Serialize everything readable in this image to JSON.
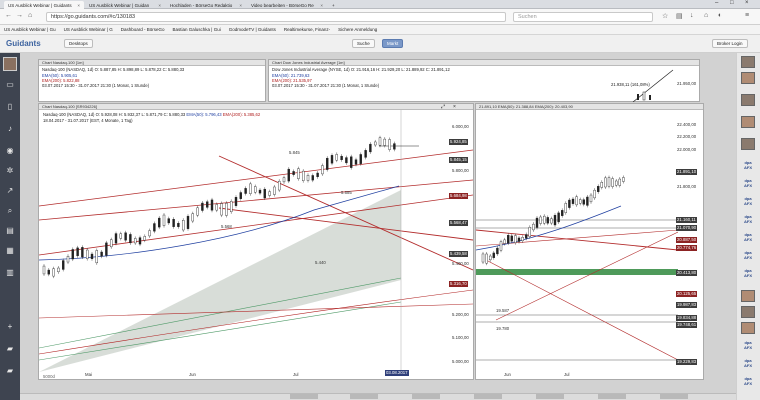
{
  "browser": {
    "tabs": [
      {
        "label": "US Ausblick Webinar | Guidants",
        "active": true
      },
      {
        "label": "US Ausblick Webinar | Guidan",
        "active": false
      },
      {
        "label": "Hochladen - BörseGo Redaktio",
        "active": false
      },
      {
        "label": "Video bearbeiten - BörseGo Re",
        "active": false
      }
    ],
    "url": "https://go.guidants.com/#c/130183",
    "search_placeholder": "Suchen",
    "bookmarks": [
      "US Ausblick Webinar | Gu",
      "US Ausblick Webinar | G",
      "Dashboard - BörseGo",
      "Bastian Galuschka | Gui",
      "GodmodeTV | Guidants",
      "Realtimekurse, Finanz-",
      "Sichere Anmeldung"
    ]
  },
  "app": {
    "logo": "Guidants",
    "desktop_label": "Desktops",
    "suche_label": "Suche",
    "markt_label": "Markt",
    "login_label": "Broker Login"
  },
  "top_left_chart": {
    "title": "Chart Nasdaq-100 [1m]",
    "line1": "Nasdaq-100 (NASDAQ, 1d)  O: 5.887,85  H: 5.898,89  L: 5.878,22  C: 5.880,33",
    "ema50": "EMA(50): 5.905,61",
    "ema200": "EMA(200): 5.822,88",
    "range": "03.07.2017 15:30 - 31.07.2017 21:30    (1 Monat, 1 Stunde)"
  },
  "top_right_chart": {
    "title": "Chart Dow Jones Industrial Average [1m]",
    "line1": "Dow Jones Industrial Average (NYSE, 1d)  O: 21.916,16  H: 21.929,20  L: 21.889,92  C: 21.891,12",
    "ema50": "EMA(50): 21.739,63",
    "ema200": "EMA(200): 21.535,97",
    "range": "03.07.2017 15:30 - 31.07.2017 21:30    (1 Monat, 1 Stunde)",
    "price_label": "21.950,00",
    "mid_value": "21.938,11 (161,08%)"
  },
  "main_chart": {
    "title": "Chart Nasdaq-100 [SR934226]",
    "line1": "Nasdaq-100 (NASDAQ, 1d)  O: 5.928,08  H: 5.932,37  L: 5.871,79  C: 5.880,33",
    "ema50": "EMA(50): 5.796,43",
    "ema200": "EMA(200): 5.385,62",
    "range": "18.04.2017 - 31.07.2017    (EST, 4 Monate, 1 Tag)",
    "annotations": [
      "5.845",
      "5.685",
      "5.568",
      "5.440"
    ],
    "price_levels": [
      "6.000,00",
      "5.924,85",
      "5.845,15",
      "5.800,00",
      "5.684,98",
      "5.568,47",
      "5.439,58",
      "5.400,00",
      "5.316,70",
      "5.200,00",
      "5.100,00",
      "5.000,00"
    ],
    "x_labels": [
      "Mai",
      "Jun",
      "Jul"
    ],
    "date_tag": "03.08.2017",
    "footer_left": "5000d"
  },
  "right_chart": {
    "header": "21.891,10  EMA(50): 21.388,84  EMA(200): 20.403,90",
    "price_levels": [
      "22.400,00",
      "22.200,00",
      "22.000,00",
      "21.891,10",
      "21.800,00",
      "21.160,11",
      "21.070,90",
      "20.887,50",
      "20.774,76",
      "20.413,80",
      "20.125,65",
      "19.987,83",
      "19.834,88",
      "19.748,61",
      "19.229,83"
    ],
    "annotations": [
      "19.587",
      "19.780"
    ],
    "x_labels": [
      "Jun",
      "Jul"
    ]
  },
  "colors": {
    "sidebar": "#3e4450",
    "ema50": "#1f3fa0",
    "ema200": "#b02020",
    "trend": "#b32d2d",
    "zone": "#cfd8cf",
    "green_band": "#4e9a5a"
  }
}
